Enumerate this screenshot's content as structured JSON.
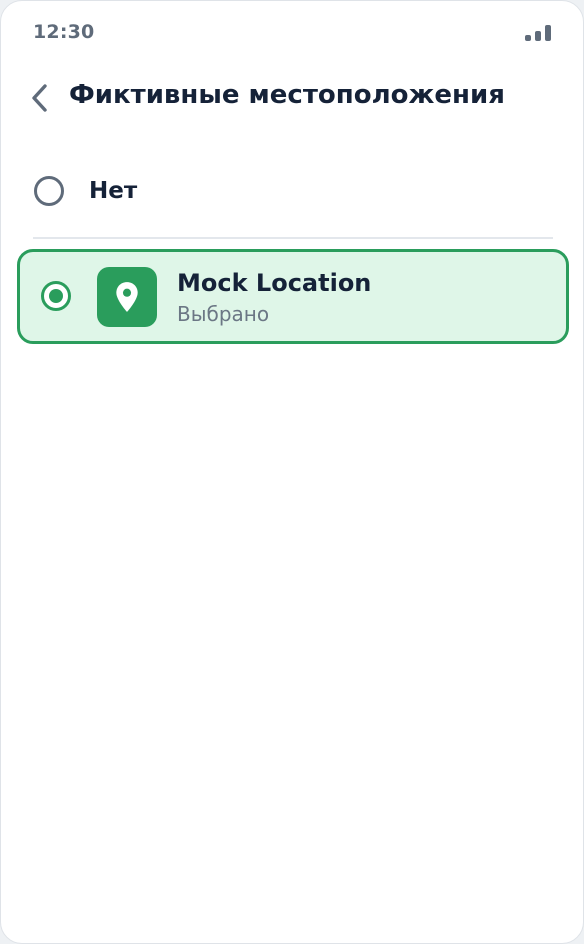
{
  "status_bar": {
    "time": "12:30",
    "signal_icon": "signal-icon"
  },
  "header": {
    "back_icon": "chevron-left-icon",
    "title": "Фиктивные местоположения"
  },
  "options": {
    "none": {
      "label": "Нет",
      "selected": false
    },
    "mock": {
      "app_name": "Mock Location",
      "status": "Выбрано",
      "icon": "location-pin-icon",
      "selected": true
    }
  },
  "colors": {
    "accent": "#2a9d5c",
    "selected_background": "#dff6e8",
    "title_text": "#152238",
    "muted_text": "#5f6b7a"
  }
}
